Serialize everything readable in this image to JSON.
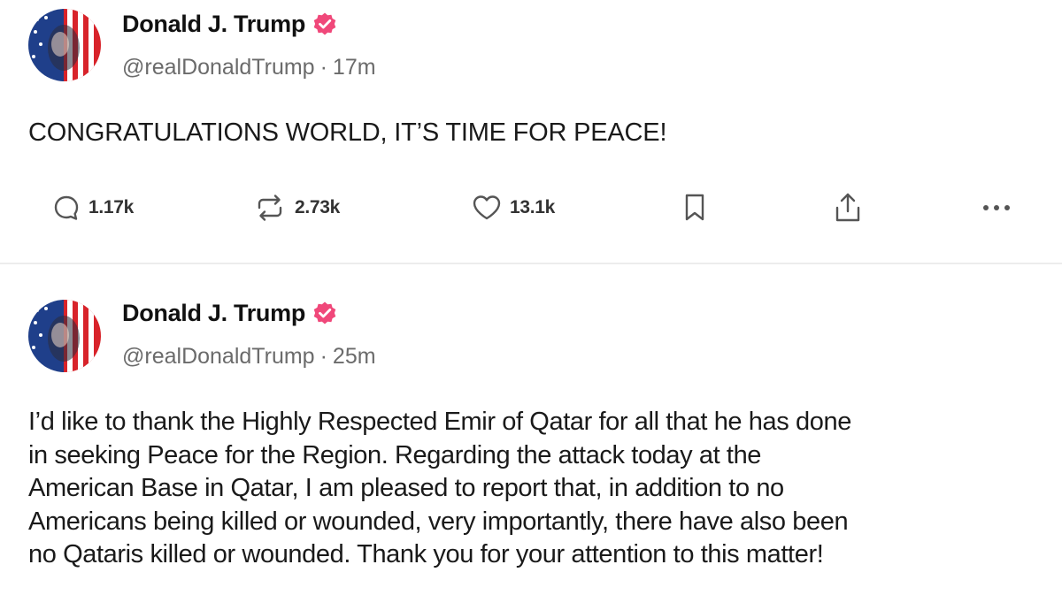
{
  "colors": {
    "verified_badge": "#f0487a",
    "text": "#1a1a1a",
    "muted": "#6b6b6b",
    "icon": "#555555",
    "divider": "#ececec"
  },
  "posts": [
    {
      "author": {
        "name": "Donald J. Trump",
        "handle": "@realDonaldTrump",
        "verified_icon": "verified-badge-icon"
      },
      "meta_separator": "·",
      "time": "17m",
      "text": "CONGRATULATIONS WORLD, IT’S TIME FOR PEACE!",
      "actions": {
        "replies": "1.17k",
        "reposts": "2.73k",
        "likes": "13.1k",
        "icons": [
          "reply-icon",
          "repost-icon",
          "heart-icon",
          "bookmark-icon",
          "share-icon",
          "more-icon"
        ]
      }
    },
    {
      "author": {
        "name": "Donald J. Trump",
        "handle": "@realDonaldTrump",
        "verified_icon": "verified-badge-icon"
      },
      "meta_separator": "·",
      "time": "25m",
      "text_lines": [
        "I’d like to thank the Highly Respected Emir of Qatar for all that he has done",
        "in seeking Peace for the Region. Regarding the attack today at the",
        "American Base in Qatar, I am pleased to report that, in addition to no",
        "Americans being killed or wounded, very importantly, there have also been",
        "no Qataris killed or wounded. Thank you for your attention to this matter!"
      ]
    }
  ]
}
